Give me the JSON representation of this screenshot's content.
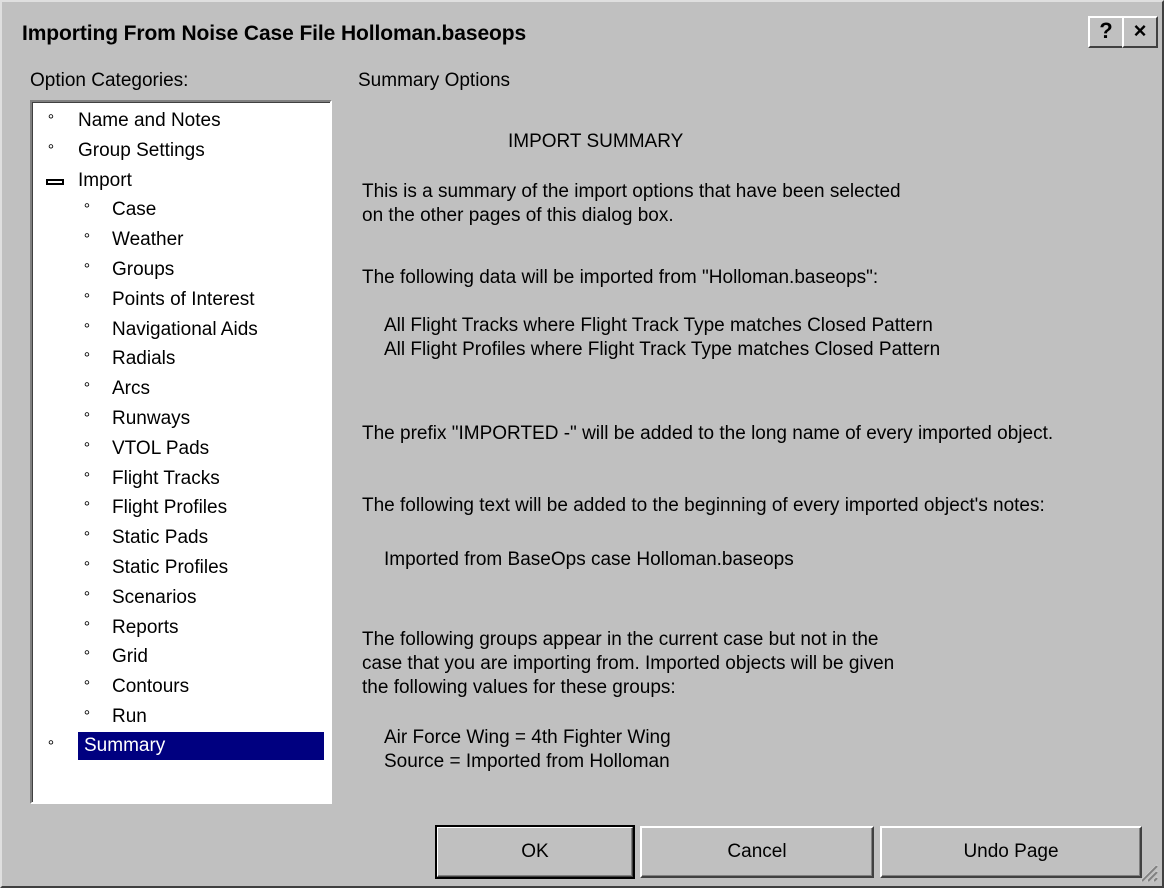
{
  "window": {
    "title": "Importing From Noise Case File Holloman.baseops",
    "help_label": "?",
    "close_label": "×"
  },
  "categories_label": "Option Categories:",
  "page_label": "Summary Options",
  "tree": {
    "items": [
      {
        "label": "Name and Notes",
        "level": 0,
        "marker": "bullet"
      },
      {
        "label": "Group Settings",
        "level": 0,
        "marker": "bullet"
      },
      {
        "label": "Import",
        "level": 0,
        "marker": "minus"
      },
      {
        "label": "Case",
        "level": 1,
        "marker": "bullet"
      },
      {
        "label": "Weather",
        "level": 1,
        "marker": "bullet"
      },
      {
        "label": "Groups",
        "level": 1,
        "marker": "bullet"
      },
      {
        "label": "Points of Interest",
        "level": 1,
        "marker": "bullet"
      },
      {
        "label": "Navigational Aids",
        "level": 1,
        "marker": "bullet"
      },
      {
        "label": "Radials",
        "level": 1,
        "marker": "bullet"
      },
      {
        "label": "Arcs",
        "level": 1,
        "marker": "bullet"
      },
      {
        "label": "Runways",
        "level": 1,
        "marker": "bullet"
      },
      {
        "label": "VTOL Pads",
        "level": 1,
        "marker": "bullet"
      },
      {
        "label": "Flight Tracks",
        "level": 1,
        "marker": "bullet"
      },
      {
        "label": "Flight Profiles",
        "level": 1,
        "marker": "bullet"
      },
      {
        "label": "Static Pads",
        "level": 1,
        "marker": "bullet"
      },
      {
        "label": "Static Profiles",
        "level": 1,
        "marker": "bullet"
      },
      {
        "label": "Scenarios",
        "level": 1,
        "marker": "bullet"
      },
      {
        "label": "Reports",
        "level": 1,
        "marker": "bullet"
      },
      {
        "label": "Grid",
        "level": 1,
        "marker": "bullet"
      },
      {
        "label": "Contours",
        "level": 1,
        "marker": "bullet"
      },
      {
        "label": "Run",
        "level": 1,
        "marker": "bullet"
      },
      {
        "label": "Summary",
        "level": 0,
        "marker": "bullet",
        "selected": true
      }
    ]
  },
  "summary": {
    "heading": "IMPORT SUMMARY",
    "intro_1": "This is a summary of the import options that have been selected",
    "intro_2": "on the other pages of this dialog box.",
    "data_intro": "The following data will be imported from \"Holloman.baseops\":",
    "data_1": "All Flight Tracks where Flight Track Type matches Closed Pattern",
    "data_2": "All Flight Profiles where Flight Track Type matches Closed Pattern",
    "prefix_text": "The prefix \"IMPORTED -\" will be added to the long name of every imported object.",
    "notes_intro": "The following text will be added to the beginning of every imported object's notes:",
    "notes_text": "Imported from BaseOps case Holloman.baseops",
    "groups_1": "The following groups appear in the current case but not in the",
    "groups_2": "case that you are importing from.  Imported objects will be given",
    "groups_3": "the following values for these groups:",
    "group_value_1": "Air Force Wing = 4th Fighter Wing",
    "group_value_2": "Source = Imported from Holloman"
  },
  "buttons": {
    "ok": "OK",
    "cancel": "Cancel",
    "undo": "Undo Page"
  },
  "colors": {
    "face": "#c0c0c0",
    "selection": "#000080"
  }
}
